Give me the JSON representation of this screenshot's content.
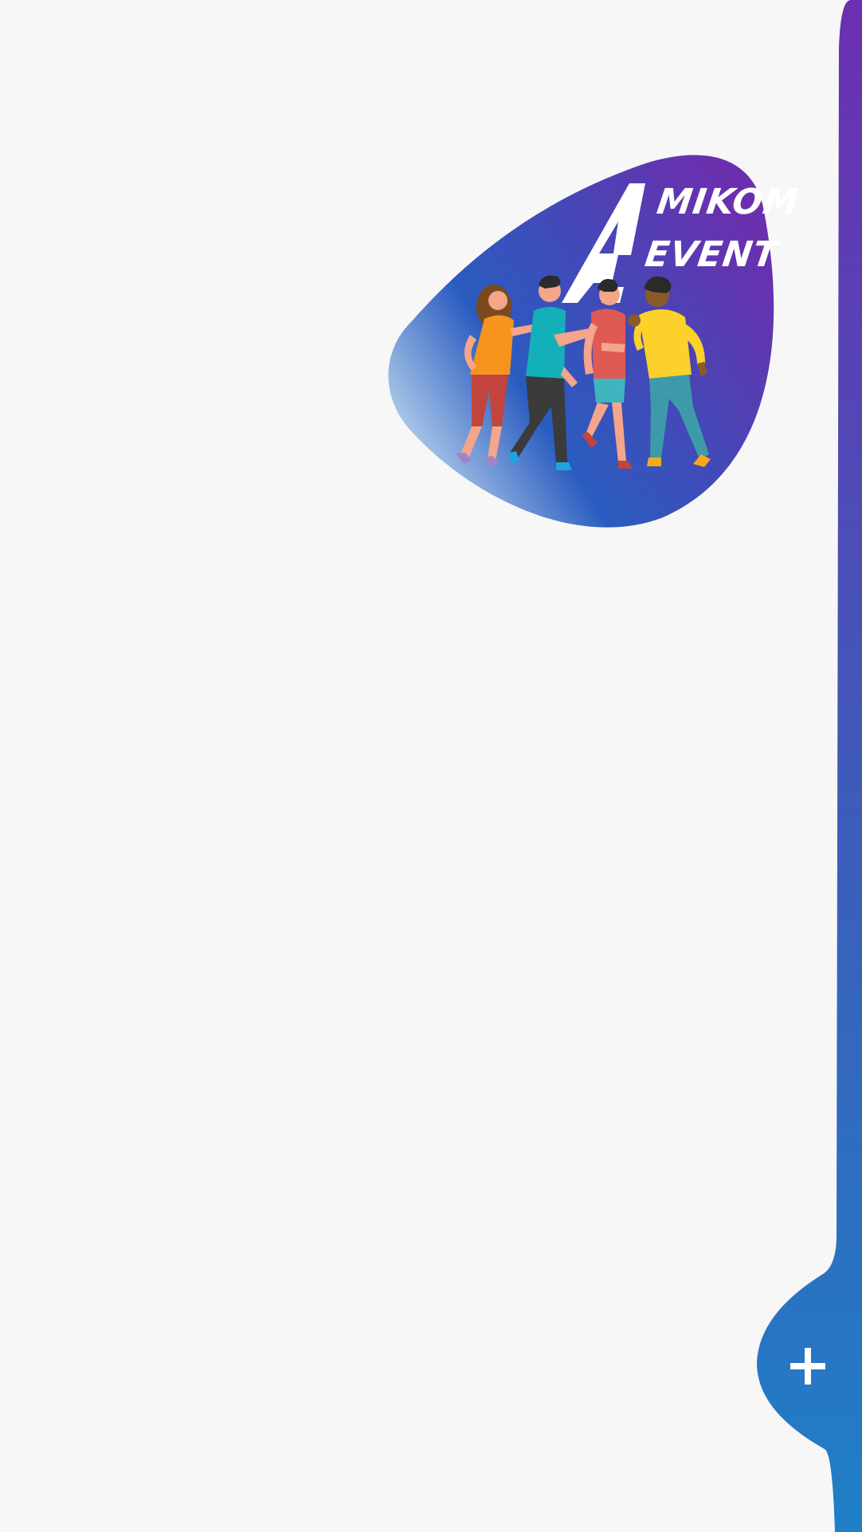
{
  "logo": {
    "line1": "MIKOM",
    "line2": "EVENT",
    "brand_mark": "A"
  },
  "fab": {
    "icon": "plus-icon"
  },
  "colors": {
    "background": "#f7f7f7",
    "gradient_top": "#6c2fb0",
    "gradient_bottom": "#1f7fc7",
    "logo_blob_purple": "#6b2fae",
    "logo_blob_blue": "#2a5cc0",
    "logo_blob_light": "#9cc0e6"
  }
}
